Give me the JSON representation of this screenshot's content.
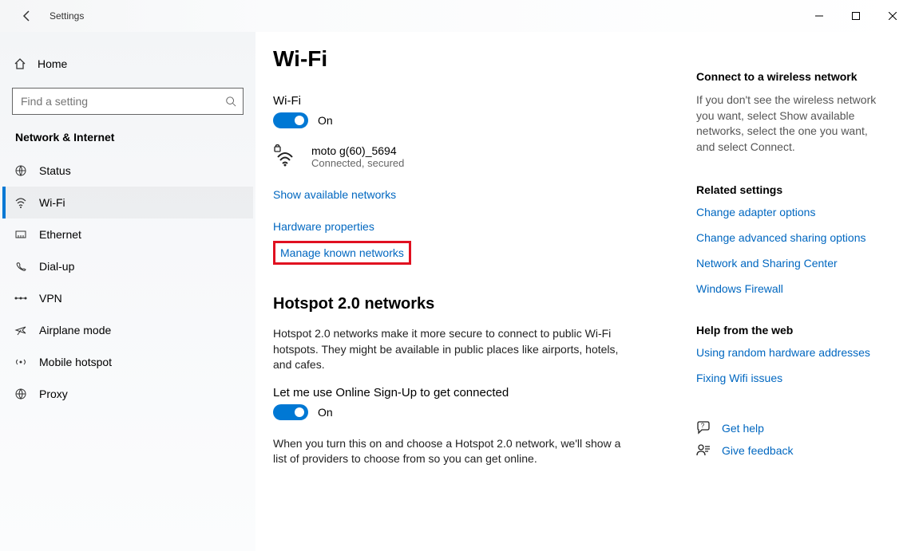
{
  "titlebar": {
    "title": "Settings"
  },
  "sidebar": {
    "home": "Home",
    "search_placeholder": "Find a setting",
    "header": "Network & Internet",
    "items": [
      {
        "label": "Status"
      },
      {
        "label": "Wi-Fi"
      },
      {
        "label": "Ethernet"
      },
      {
        "label": "Dial-up"
      },
      {
        "label": "VPN"
      },
      {
        "label": "Airplane mode"
      },
      {
        "label": "Mobile hotspot"
      },
      {
        "label": "Proxy"
      }
    ]
  },
  "main": {
    "title": "Wi-Fi",
    "wifi_section_label": "Wi-Fi",
    "wifi_toggle_state": "On",
    "connection": {
      "name": "moto g(60)_5694",
      "status": "Connected, secured"
    },
    "link_show_networks": "Show available networks",
    "link_hw_props": "Hardware properties",
    "link_manage_known": "Manage known networks",
    "hotspot_title": "Hotspot 2.0 networks",
    "hotspot_desc": "Hotspot 2.0 networks make it more secure to connect to public Wi-Fi hotspots. They might be available in public places like airports, hotels, and cafes.",
    "hotspot_toggle_label": "Let me use Online Sign-Up to get connected",
    "hotspot_toggle_state": "On",
    "hotspot_footer": "When you turn this on and choose a Hotspot 2.0 network, we'll show a list of providers to choose from so you can get online."
  },
  "aside": {
    "connect_title": "Connect to a wireless network",
    "connect_desc": "If you don't see the wireless network you want, select Show available networks, select the one you want, and select Connect.",
    "related_title": "Related settings",
    "related_links": [
      "Change adapter options",
      "Change advanced sharing options",
      "Network and Sharing Center",
      "Windows Firewall"
    ],
    "help_title": "Help from the web",
    "help_links": [
      "Using random hardware addresses",
      "Fixing Wifi issues"
    ],
    "get_help": "Get help",
    "feedback": "Give feedback"
  }
}
